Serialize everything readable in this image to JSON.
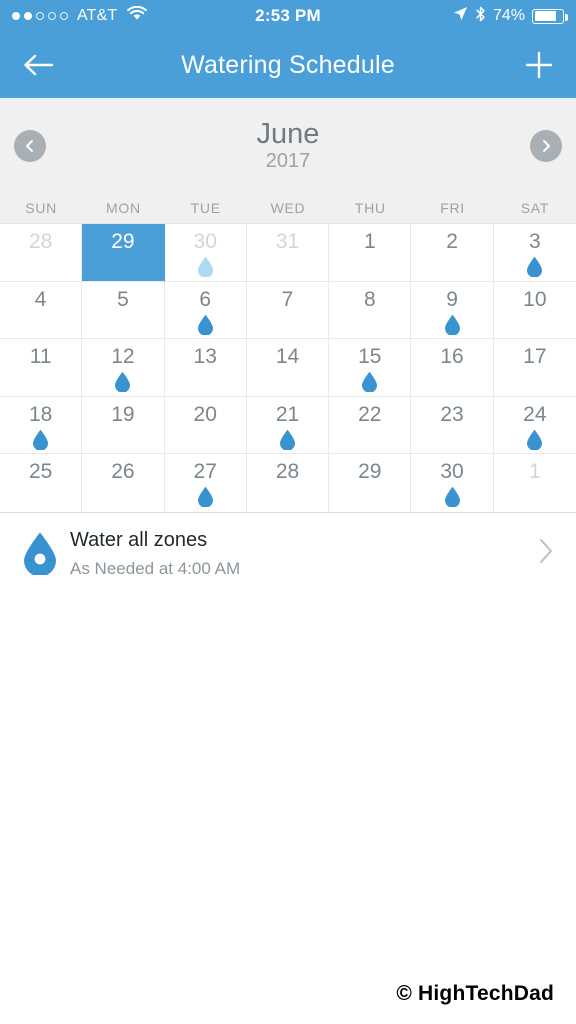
{
  "status_bar": {
    "signal_filled": 2,
    "signal_total": 5,
    "carrier": "AT&T",
    "wifi_icon": "wifi-icon",
    "time": "2:53 PM",
    "location_icon": "location-arrow-icon",
    "bluetooth_icon": "bluetooth-icon",
    "battery_percent": "74%",
    "battery_level": 70
  },
  "nav_bar": {
    "back_icon": "arrow-left-icon",
    "title": "Watering Schedule",
    "add_icon": "plus-icon",
    "background": "#4a9fd8"
  },
  "month_header": {
    "prev_icon": "chevron-left-circle-icon",
    "next_icon": "chevron-right-circle-icon",
    "month": "June",
    "year": "2017"
  },
  "weekdays": [
    "SUN",
    "MON",
    "TUE",
    "WED",
    "THU",
    "FRI",
    "SAT"
  ],
  "calendar": {
    "selected_color": "#4a9fd8",
    "droplet_color": "#3a93d1",
    "droplet_faded_color": "#aed9f0",
    "rows": [
      [
        {
          "day": "28",
          "muted": true,
          "droplet": "none"
        },
        {
          "day": "29",
          "muted": false,
          "droplet": "none",
          "selected": true
        },
        {
          "day": "30",
          "muted": true,
          "droplet": "faded"
        },
        {
          "day": "31",
          "muted": true,
          "droplet": "none"
        },
        {
          "day": "1",
          "muted": false,
          "droplet": "none"
        },
        {
          "day": "2",
          "muted": false,
          "droplet": "none"
        },
        {
          "day": "3",
          "muted": false,
          "droplet": "full"
        }
      ],
      [
        {
          "day": "4",
          "muted": false,
          "droplet": "none"
        },
        {
          "day": "5",
          "muted": false,
          "droplet": "none"
        },
        {
          "day": "6",
          "muted": false,
          "droplet": "full"
        },
        {
          "day": "7",
          "muted": false,
          "droplet": "none"
        },
        {
          "day": "8",
          "muted": false,
          "droplet": "none"
        },
        {
          "day": "9",
          "muted": false,
          "droplet": "full"
        },
        {
          "day": "10",
          "muted": false,
          "droplet": "none"
        }
      ],
      [
        {
          "day": "11",
          "muted": false,
          "droplet": "none"
        },
        {
          "day": "12",
          "muted": false,
          "droplet": "full"
        },
        {
          "day": "13",
          "muted": false,
          "droplet": "none"
        },
        {
          "day": "14",
          "muted": false,
          "droplet": "none"
        },
        {
          "day": "15",
          "muted": false,
          "droplet": "full"
        },
        {
          "day": "16",
          "muted": false,
          "droplet": "none"
        },
        {
          "day": "17",
          "muted": false,
          "droplet": "none"
        }
      ],
      [
        {
          "day": "18",
          "muted": false,
          "droplet": "full"
        },
        {
          "day": "19",
          "muted": false,
          "droplet": "none"
        },
        {
          "day": "20",
          "muted": false,
          "droplet": "none"
        },
        {
          "day": "21",
          "muted": false,
          "droplet": "full"
        },
        {
          "day": "22",
          "muted": false,
          "droplet": "none"
        },
        {
          "day": "23",
          "muted": false,
          "droplet": "none"
        },
        {
          "day": "24",
          "muted": false,
          "droplet": "full"
        }
      ],
      [
        {
          "day": "25",
          "muted": false,
          "droplet": "none"
        },
        {
          "day": "26",
          "muted": false,
          "droplet": "none"
        },
        {
          "day": "27",
          "muted": false,
          "droplet": "full"
        },
        {
          "day": "28",
          "muted": false,
          "droplet": "none"
        },
        {
          "day": "29",
          "muted": false,
          "droplet": "none"
        },
        {
          "day": "30",
          "muted": false,
          "droplet": "full"
        },
        {
          "day": "1",
          "muted": true,
          "droplet": "none"
        }
      ]
    ]
  },
  "schedule_list": [
    {
      "icon": "water-droplet-icon",
      "title": "Water all zones",
      "subtitle": "As Needed at 4:00 AM",
      "chevron": "chevron-right-icon"
    }
  ],
  "watermark": {
    "symbol": "©",
    "text": "HighTechDad"
  }
}
